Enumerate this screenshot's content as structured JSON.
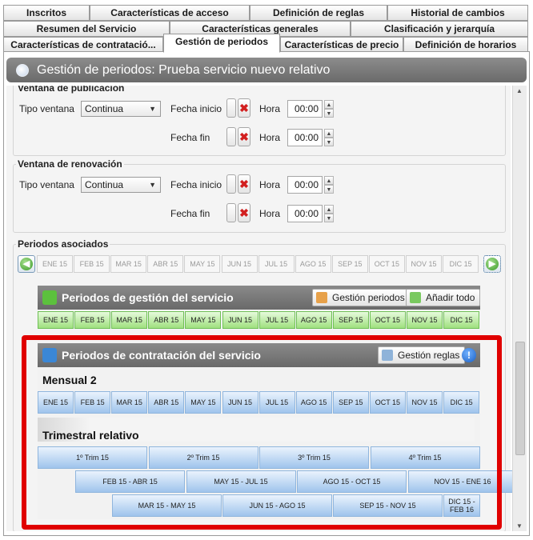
{
  "tabs": {
    "row1": [
      "Inscritos",
      "Características de acceso",
      "Definición de reglas",
      "Historial de cambios"
    ],
    "row2": [
      "Resumen del Servicio",
      "Características generales",
      "Clasificación y jerarquía"
    ],
    "row3": [
      "Características de contratació...",
      "Gestión de periodos",
      "Características de precio",
      "Definición de horarios"
    ]
  },
  "title": "Gestión de periodos: Prueba servicio nuevo relativo",
  "publicacion": {
    "title": "Ventana de publicación",
    "tipo_label": "Tipo ventana",
    "tipo_value": "Continua",
    "fecha_inicio_label": "Fecha inicio",
    "fecha_fin_label": "Fecha fin",
    "hora_label": "Hora",
    "hora_inicio": "00:00",
    "hora_fin": "00:00"
  },
  "renovacion": {
    "title": "Ventana de renovación",
    "tipo_label": "Tipo ventana",
    "tipo_value": "Continua",
    "fecha_inicio_label": "Fecha inicio",
    "fecha_fin_label": "Fecha fin",
    "hora_label": "Hora",
    "hora_inicio": "00:00",
    "hora_fin": "00:00"
  },
  "asociados": {
    "title": "Periodos asociados",
    "months": [
      "ENE 15",
      "FEB 15",
      "MAR 15",
      "ABR 15",
      "MAY 15",
      "JUN 15",
      "JUL 15",
      "AGO 15",
      "SEP 15",
      "OCT 15",
      "NOV 15",
      "DIC 15"
    ]
  },
  "gestion": {
    "title": "Periodos de gestión del servicio",
    "btn_gestion": "Gestión periodos",
    "btn_anadir": "Añadir todo",
    "months": [
      "ENE 15",
      "FEB 15",
      "MAR 15",
      "ABR 15",
      "MAY 15",
      "JUN 15",
      "JUL 15",
      "AGO 15",
      "SEP 15",
      "OCT 15",
      "NOV 15",
      "DIC 15"
    ]
  },
  "contratacion": {
    "title": "Periodos de contratación del servicio",
    "btn_reglas": "Gestión reglas",
    "mensual_title": "Mensual 2",
    "mensual": [
      "ENE 15",
      "FEB 15",
      "MAR 15",
      "ABR 15",
      "MAY 15",
      "JUN 15",
      "JUL 15",
      "AGO 15",
      "SEP 15",
      "OCT 15",
      "NOV 15",
      "DIC 15"
    ],
    "trimestral_title": "Trimestral relativo",
    "trim_row1": [
      "1º Trim 15",
      "2º Trim 15",
      "3º Trim 15",
      "4º Trim 15"
    ],
    "trim_row2": [
      "FEB 15 - ABR 15",
      "MAY 15 - JUL 15",
      "AGO 15 - OCT 15",
      "NOV 15 - ENE 16"
    ],
    "trim_row3": [
      "MAR 15 - MAY 15",
      "JUN 15 - AGO 15",
      "SEP 15 - NOV 15",
      "DIC 15 - FEB 16"
    ]
  },
  "colors": {
    "highlight": "#e00000",
    "green_cell": "#9fe07f",
    "blue_cell": "#9fc4ec",
    "header_gray": "#7a7a7a"
  }
}
